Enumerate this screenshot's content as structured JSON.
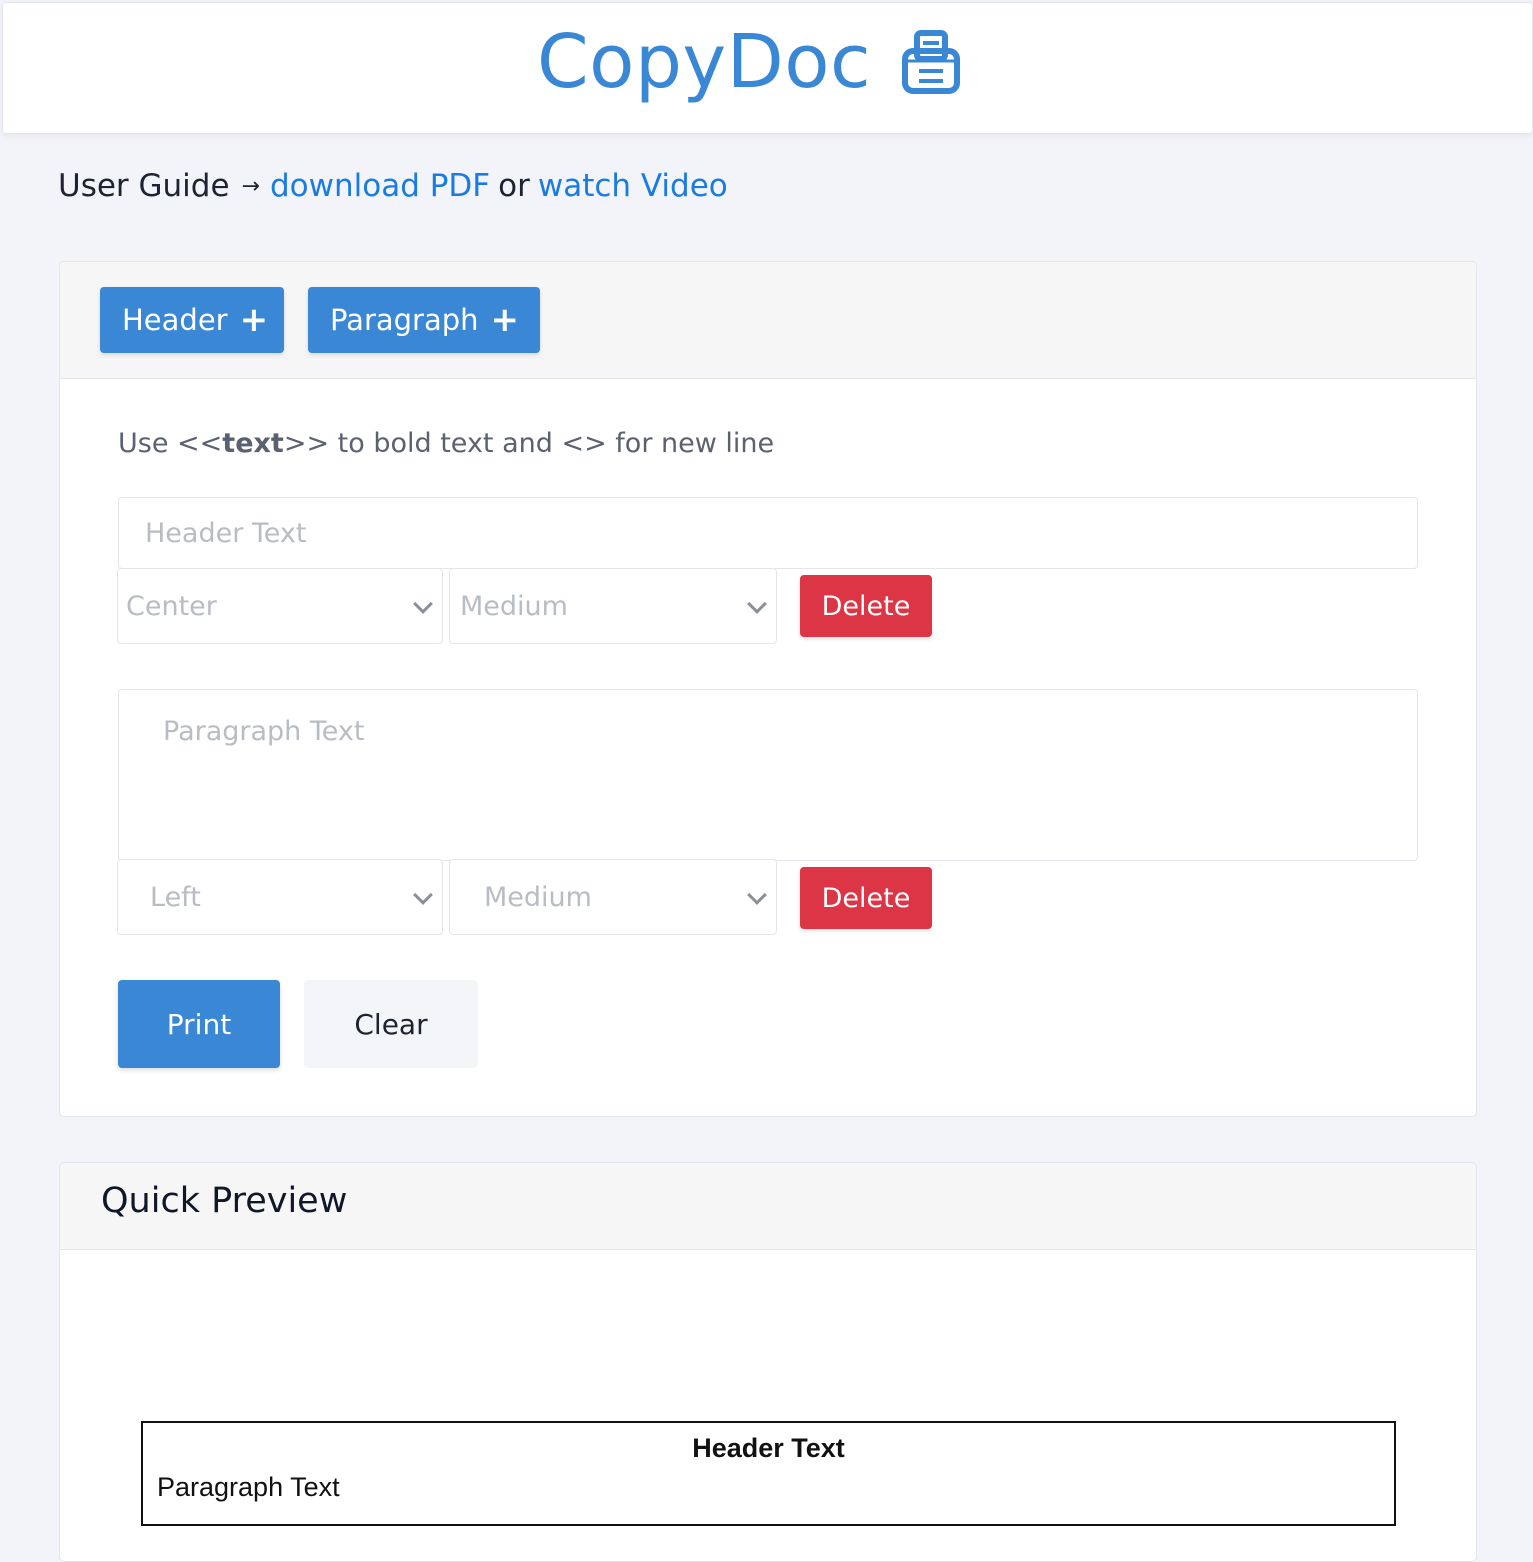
{
  "app": {
    "title": "CopyDoc",
    "logo_icon": "printer-icon",
    "accent_color": "#3a87d6"
  },
  "guide": {
    "label": "User Guide",
    "arrow": "→",
    "pdf_link": "download PDF",
    "or": "or",
    "video_link": "watch Video"
  },
  "editor": {
    "add_header_label": "Header",
    "add_paragraph_label": "Paragraph",
    "plus_icon": "+",
    "hint": {
      "prefix": "Use <<",
      "bold": "text",
      "suffix": ">> to bold text and <> for new line"
    },
    "blocks": [
      {
        "type": "header",
        "placeholder": "Header Text",
        "value": "",
        "align": "Center",
        "size": "Medium",
        "delete_label": "Delete"
      },
      {
        "type": "paragraph",
        "placeholder": "Paragraph Text",
        "value": "",
        "align": "Left",
        "size": "Medium",
        "delete_label": "Delete"
      }
    ],
    "print_label": "Print",
    "clear_label": "Clear",
    "delete_color": "#dc3545"
  },
  "preview": {
    "title": "Quick Preview",
    "header_text": "Header Text",
    "paragraph_text": "Paragraph Text"
  }
}
